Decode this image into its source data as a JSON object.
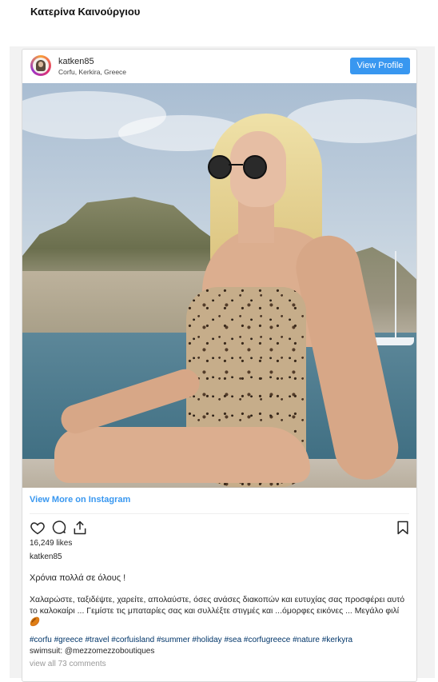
{
  "page": {
    "title": "Κατερίνα Καινούργιου"
  },
  "post": {
    "username": "katken85",
    "location": "Corfu, Kerkira, Greece",
    "view_profile_label": "View Profile",
    "view_more_label": "View More on Instagram",
    "likes": "16,249 likes",
    "author": "katken85",
    "caption_line1": "Χρόνια πολλά σε όλους !",
    "caption_body": "Χαλαρώστε, ταξιδέψτε, χαρείτε, απολαύστε, όσες ανάσες διακοπών και ευτυχίας σας προσφέρει αυτό το καλοκαίρι ... Γεμίστε τις μπαταρίες σας και συλλέξτε στιγμές και ...όμορφες εικόνες ... Μεγάλο φιλί 🏉",
    "hashtags": "#corfu #greece #travel #corfuisland #summer #holiday #sea #corfugreece #nature #kerkyra",
    "swimsuit": "swimsuit: @mezzomezzoboutiques",
    "comments": "view all 73 comments"
  },
  "icons": {
    "like": "heart-icon",
    "comment": "comment-icon",
    "share": "share-icon",
    "save": "bookmark-icon"
  },
  "colors": {
    "accent": "#3897f0",
    "link_text": "#003569"
  }
}
